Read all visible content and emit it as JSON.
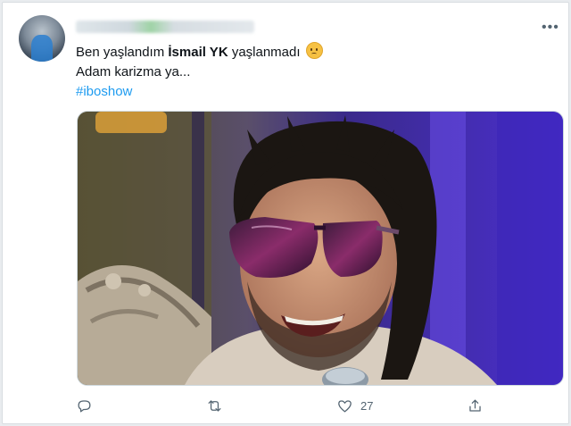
{
  "tweet": {
    "line1_pre": "Ben yaşlandım ",
    "line1_bold": "İsmail YK",
    "line1_post": " yaşlanmadı",
    "line2": "Adam karizma ya...",
    "hashtag": "#iboshow"
  },
  "media": {
    "subject": "smiling man with long dark hair and purple wraparound sunglasses on a purple-lit studio set"
  },
  "actions": {
    "reply_icon": "reply-icon",
    "retweet_icon": "retweet-icon",
    "like_icon": "like-icon",
    "like_count": "27",
    "share_icon": "share-icon"
  },
  "colors": {
    "accent": "#1d9bf0",
    "text": "#0f1419",
    "muted": "#536471"
  }
}
